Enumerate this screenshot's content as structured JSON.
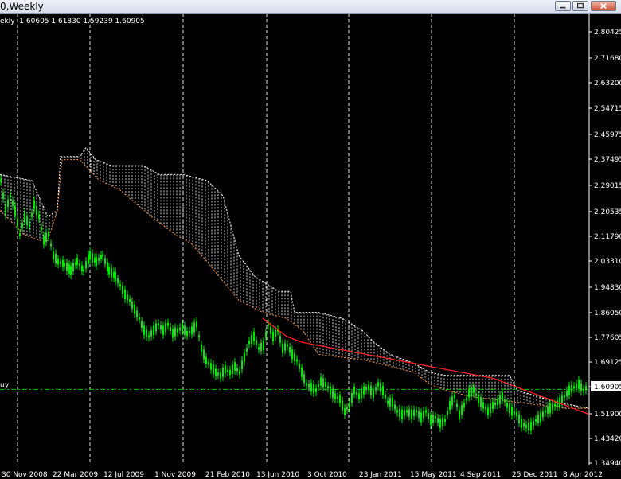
{
  "window": {
    "title": "0,Weekly",
    "buttons": [
      "minimize",
      "maximize",
      "close"
    ]
  },
  "chart": {
    "info_line": "ekly  1.60605 1.61830 1.59239 1.60905",
    "hline_label": "uy",
    "current_price": "1.60905",
    "colors": {
      "background": "#000000",
      "candles": "#00e800",
      "kijun": "#ff2020",
      "cloud": "#ffffff",
      "cloud_edge": "#ff8c3a",
      "grid": "#ffffff",
      "hline": "#00c000",
      "axis_text": "#ffffff"
    }
  },
  "chart_data": {
    "type": "candlestick",
    "title": "",
    "y_ticks": [
      "2.80425",
      "2.71680",
      "2.63200",
      "2.54715",
      "2.45975",
      "2.37495",
      "2.29015",
      "2.20535",
      "2.11790",
      "2.03310",
      "1.94830",
      "1.86050",
      "1.77605",
      "1.69125",
      "1.60905",
      "1.51900",
      "1.43420",
      "1.34940"
    ],
    "x_ticks": [
      "30 Nov 2008",
      "22 Mar 2009",
      "12 Jul 2009",
      "1 Nov 2009",
      "21 Feb 2010",
      "13 Jun 2010",
      "3 Oct 2010",
      "23 Jan 2011",
      "15 May 2011",
      "4 Sep 2011",
      "25 Dec 2011",
      "8 Apr 2012"
    ],
    "ylim": [
      1.3494,
      2.8572
    ],
    "horizontal_line": 1.6031,
    "price_path": [
      [
        0,
        2.3
      ],
      [
        6,
        2.2
      ],
      [
        12,
        2.25
      ],
      [
        18,
        2.2
      ],
      [
        24,
        2.12
      ],
      [
        30,
        2.18
      ],
      [
        36,
        2.15
      ],
      [
        42,
        2.22
      ],
      [
        48,
        2.18
      ],
      [
        54,
        2.1
      ],
      [
        60,
        2.12
      ],
      [
        66,
        2.05
      ],
      [
        72,
        2.03
      ],
      [
        80,
        2.02
      ],
      [
        88,
        2.0
      ],
      [
        96,
        2.03
      ],
      [
        104,
        2.0
      ],
      [
        112,
        2.05
      ],
      [
        120,
        2.03
      ],
      [
        128,
        2.05
      ],
      [
        136,
        2.0
      ],
      [
        144,
        1.98
      ],
      [
        150,
        1.95
      ],
      [
        156,
        1.92
      ],
      [
        162,
        1.9
      ],
      [
        168,
        1.87
      ],
      [
        174,
        1.84
      ],
      [
        180,
        1.8
      ],
      [
        186,
        1.78
      ],
      [
        192,
        1.8
      ],
      [
        198,
        1.82
      ],
      [
        204,
        1.8
      ],
      [
        210,
        1.82
      ],
      [
        216,
        1.79
      ],
      [
        222,
        1.8
      ],
      [
        228,
        1.81
      ],
      [
        234,
        1.79
      ],
      [
        240,
        1.8
      ],
      [
        246,
        1.82
      ],
      [
        252,
        1.74
      ],
      [
        258,
        1.7
      ],
      [
        264,
        1.68
      ],
      [
        270,
        1.66
      ],
      [
        276,
        1.65
      ],
      [
        282,
        1.67
      ],
      [
        288,
        1.66
      ],
      [
        294,
        1.68
      ],
      [
        300,
        1.66
      ],
      [
        306,
        1.71
      ],
      [
        312,
        1.76
      ],
      [
        318,
        1.78
      ],
      [
        324,
        1.74
      ],
      [
        330,
        1.75
      ],
      [
        336,
        1.82
      ],
      [
        342,
        1.78
      ],
      [
        348,
        1.8
      ],
      [
        354,
        1.74
      ],
      [
        360,
        1.75
      ],
      [
        366,
        1.72
      ],
      [
        372,
        1.7
      ],
      [
        378,
        1.66
      ],
      [
        384,
        1.62
      ],
      [
        390,
        1.61
      ],
      [
        396,
        1.6
      ],
      [
        402,
        1.63
      ],
      [
        408,
        1.62
      ],
      [
        414,
        1.6
      ],
      [
        420,
        1.58
      ],
      [
        426,
        1.57
      ],
      [
        432,
        1.53
      ],
      [
        438,
        1.55
      ],
      [
        444,
        1.6
      ],
      [
        450,
        1.58
      ],
      [
        456,
        1.6
      ],
      [
        462,
        1.61
      ],
      [
        468,
        1.59
      ],
      [
        474,
        1.62
      ],
      [
        480,
        1.6
      ],
      [
        486,
        1.56
      ],
      [
        492,
        1.56
      ],
      [
        498,
        1.53
      ],
      [
        504,
        1.52
      ],
      [
        510,
        1.53
      ],
      [
        516,
        1.52
      ],
      [
        522,
        1.53
      ],
      [
        528,
        1.51
      ],
      [
        534,
        1.53
      ],
      [
        540,
        1.5
      ],
      [
        546,
        1.51
      ],
      [
        552,
        1.49
      ],
      [
        558,
        1.5
      ],
      [
        564,
        1.55
      ],
      [
        570,
        1.58
      ],
      [
        576,
        1.52
      ],
      [
        582,
        1.55
      ],
      [
        588,
        1.59
      ],
      [
        594,
        1.6
      ],
      [
        600,
        1.57
      ],
      [
        606,
        1.55
      ],
      [
        612,
        1.53
      ],
      [
        618,
        1.55
      ],
      [
        624,
        1.56
      ],
      [
        630,
        1.58
      ],
      [
        636,
        1.55
      ],
      [
        642,
        1.53
      ],
      [
        648,
        1.52
      ],
      [
        654,
        1.49
      ],
      [
        660,
        1.48
      ],
      [
        666,
        1.48
      ],
      [
        672,
        1.5
      ],
      [
        678,
        1.51
      ],
      [
        684,
        1.53
      ],
      [
        690,
        1.54
      ],
      [
        696,
        1.55
      ],
      [
        702,
        1.56
      ],
      [
        708,
        1.58
      ],
      [
        714,
        1.6
      ],
      [
        720,
        1.61
      ],
      [
        726,
        1.62
      ],
      [
        732,
        1.6
      ],
      [
        736,
        1.61
      ]
    ],
    "kijun_path": [
      [
        330,
        1.84
      ],
      [
        360,
        1.78
      ],
      [
        380,
        1.76
      ],
      [
        400,
        1.75
      ],
      [
        420,
        1.74
      ],
      [
        440,
        1.73
      ],
      [
        460,
        1.72
      ],
      [
        480,
        1.71
      ],
      [
        500,
        1.7
      ],
      [
        520,
        1.69
      ],
      [
        540,
        1.68
      ],
      [
        560,
        1.67
      ],
      [
        580,
        1.66
      ],
      [
        600,
        1.65
      ],
      [
        620,
        1.64
      ],
      [
        640,
        1.62
      ],
      [
        660,
        1.6
      ],
      [
        680,
        1.58
      ],
      [
        700,
        1.56
      ],
      [
        720,
        1.54
      ],
      [
        740,
        1.52
      ]
    ],
    "cloud_upper": [
      [
        0,
        2.32
      ],
      [
        40,
        2.3
      ],
      [
        60,
        2.18
      ],
      [
        72,
        2.2
      ],
      [
        76,
        2.38
      ],
      [
        100,
        2.38
      ],
      [
        108,
        2.41
      ],
      [
        120,
        2.37
      ],
      [
        140,
        2.35
      ],
      [
        180,
        2.35
      ],
      [
        200,
        2.32
      ],
      [
        230,
        2.32
      ],
      [
        260,
        2.3
      ],
      [
        280,
        2.25
      ],
      [
        290,
        2.15
      ],
      [
        300,
        2.05
      ],
      [
        320,
        1.98
      ],
      [
        350,
        1.93
      ],
      [
        365,
        1.93
      ],
      [
        370,
        1.86
      ],
      [
        400,
        1.86
      ],
      [
        430,
        1.84
      ],
      [
        455,
        1.8
      ],
      [
        470,
        1.76
      ],
      [
        490,
        1.72
      ],
      [
        520,
        1.69
      ],
      [
        540,
        1.66
      ],
      [
        560,
        1.65
      ],
      [
        600,
        1.65
      ],
      [
        640,
        1.65
      ],
      [
        650,
        1.6
      ],
      [
        700,
        1.56
      ],
      [
        740,
        1.54
      ]
    ],
    "cloud_lower": [
      [
        0,
        2.2
      ],
      [
        30,
        2.12
      ],
      [
        50,
        2.1
      ],
      [
        60,
        2.1
      ],
      [
        72,
        2.2
      ],
      [
        78,
        2.37
      ],
      [
        100,
        2.37
      ],
      [
        125,
        2.3
      ],
      [
        150,
        2.27
      ],
      [
        190,
        2.18
      ],
      [
        220,
        2.12
      ],
      [
        240,
        2.09
      ],
      [
        260,
        2.03
      ],
      [
        275,
        1.98
      ],
      [
        300,
        1.9
      ],
      [
        330,
        1.86
      ],
      [
        360,
        1.84
      ],
      [
        380,
        1.8
      ],
      [
        400,
        1.72
      ],
      [
        430,
        1.71
      ],
      [
        460,
        1.7
      ],
      [
        490,
        1.68
      ],
      [
        520,
        1.66
      ],
      [
        540,
        1.62
      ],
      [
        560,
        1.6
      ],
      [
        590,
        1.58
      ],
      [
        620,
        1.57
      ],
      [
        650,
        1.56
      ],
      [
        680,
        1.55
      ],
      [
        710,
        1.54
      ],
      [
        740,
        1.54
      ]
    ]
  }
}
